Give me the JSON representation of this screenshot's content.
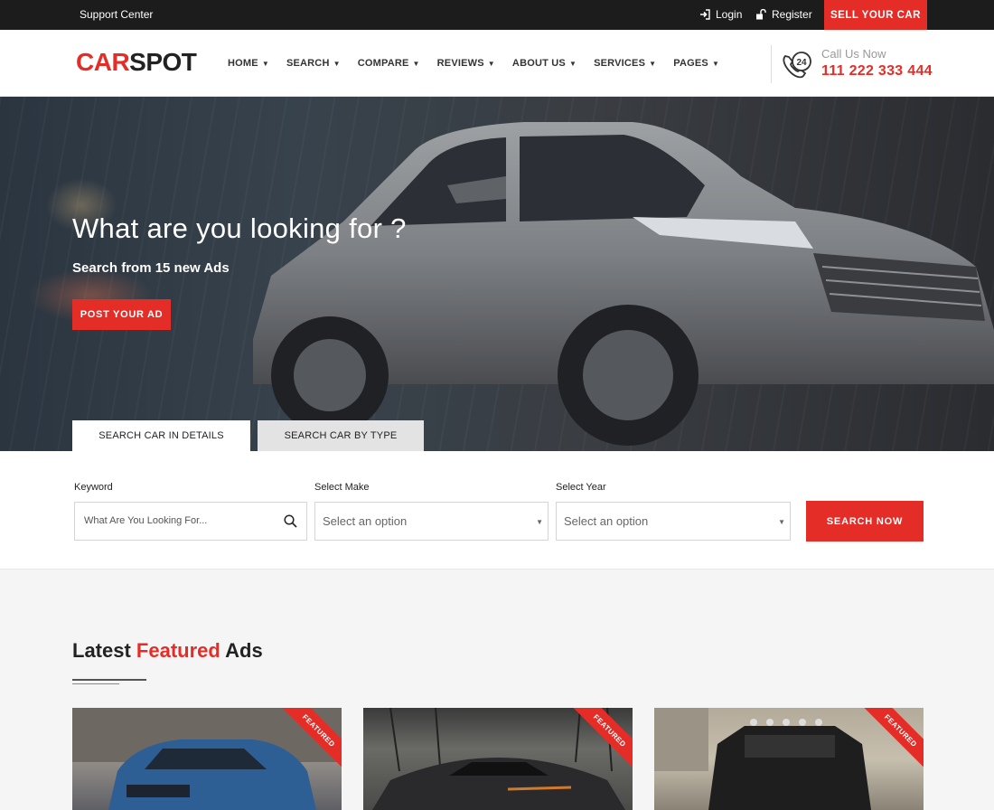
{
  "topbar": {
    "support": "Support Center",
    "login": "Login",
    "register": "Register",
    "sell": "SELL YOUR CAR"
  },
  "header": {
    "logo_a": "CAR",
    "logo_b": "SPOT",
    "nav": [
      "HOME",
      "SEARCH",
      "COMPARE",
      "REVIEWS",
      "ABOUT US",
      "SERVICES",
      "PAGES"
    ],
    "call_label": "Call Us Now",
    "call_number": "111 222 333 444",
    "phone_badge": "24"
  },
  "hero": {
    "title": "What are you looking for ?",
    "subtitle": "Search from 15 new Ads",
    "post_ad": "POST YOUR AD",
    "tab_details": "SEARCH CAR IN DETAILS",
    "tab_type": "SEARCH CAR BY TYPE"
  },
  "search": {
    "keyword_label": "Keyword",
    "keyword_placeholder": "What Are You Looking For...",
    "make_label": "Select Make",
    "make_value": "Select an option",
    "year_label": "Select Year",
    "year_value": "Select an option",
    "button": "SEARCH NOW"
  },
  "featured": {
    "title_a": "Latest",
    "title_hl": "Featured",
    "title_b": "Ads",
    "ribbon": "FEATURED"
  },
  "colors": {
    "accent": "#e52d27",
    "topbar": "#1c1c1c"
  }
}
